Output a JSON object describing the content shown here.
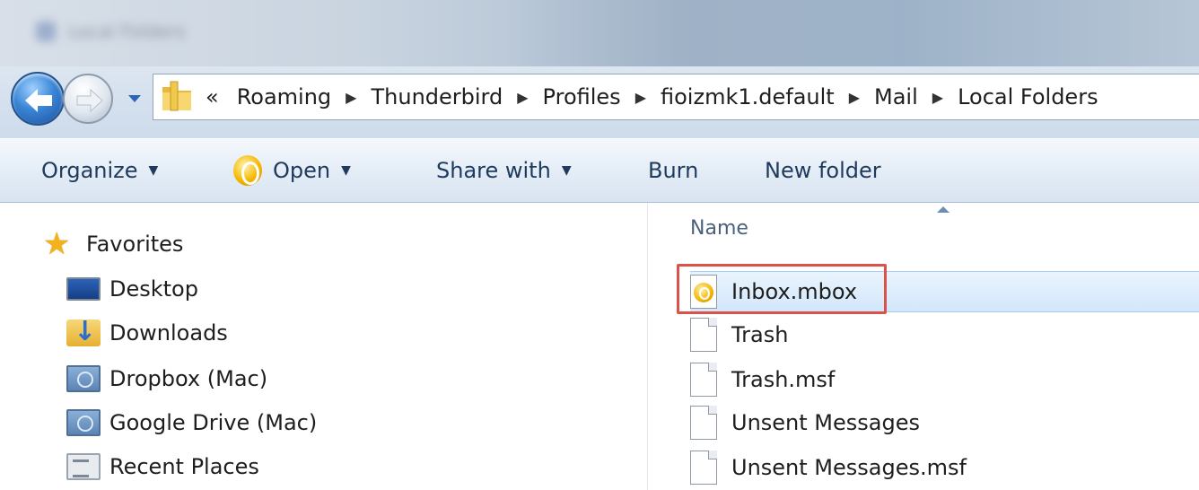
{
  "window": {
    "title": "Local Folders"
  },
  "address_bar": {
    "overflow_glyph": "«",
    "breadcrumbs": [
      "Roaming",
      "Thunderbird",
      "Profiles",
      "fioizmk1.default",
      "Mail",
      "Local Folders"
    ],
    "separator_glyph": "▶"
  },
  "command_bar": {
    "organize": "Organize",
    "open": "Open",
    "share_with": "Share with",
    "burn": "Burn",
    "new_folder": "New folder",
    "dropdown_glyph": "▼"
  },
  "nav_pane": {
    "favorites": "Favorites",
    "items": [
      "Desktop",
      "Downloads",
      "Dropbox (Mac)",
      "Google Drive (Mac)",
      "Recent Places"
    ]
  },
  "file_list": {
    "column_name": "Name",
    "files": [
      "Inbox.mbox",
      "Trash",
      "Trash.msf",
      "Unsent Messages",
      "Unsent Messages.msf"
    ],
    "selected_file": "Inbox.mbox"
  },
  "colors": {
    "highlight_outline": "#d9534a",
    "selection_fill": "#d2e7fb",
    "command_text": "#1e3a5c"
  },
  "icons": {
    "back": "back-arrow-icon",
    "forward": "forward-arrow-icon",
    "favorites": "star-icon",
    "desktop": "desktop-icon",
    "downloads": "downloads-folder-icon",
    "dropbox": "network-drive-icon",
    "google_drive": "network-drive-icon",
    "recent": "recent-places-icon",
    "mbox": "thunderbird-mbox-icon",
    "generic_file": "blank-document-icon"
  }
}
